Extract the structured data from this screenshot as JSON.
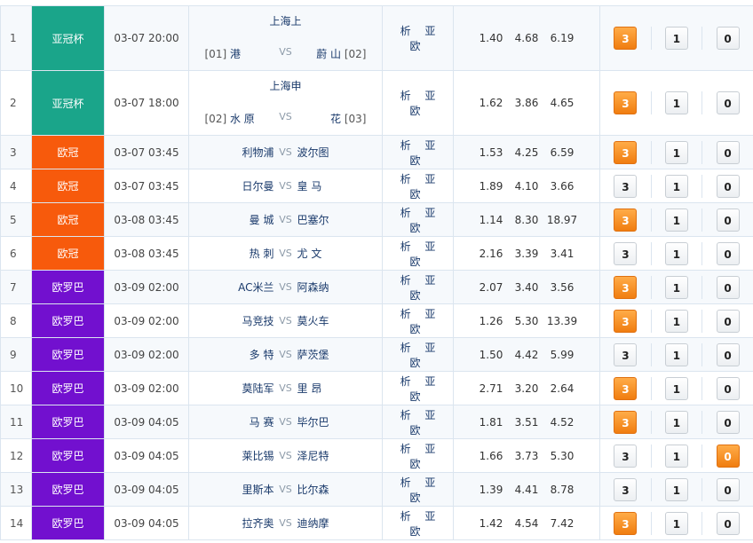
{
  "colors": {
    "league_acl": "#1aa58a",
    "league_ucl": "#f75a0c",
    "league_uel": "#7210cf",
    "selected_button": "#f5911f"
  },
  "matches": [
    {
      "index": "1",
      "league": "亚冠杯",
      "league_color": "#1aa58a",
      "time": "03-07 20:00",
      "home_top": "上海上",
      "home_rank": "[01]",
      "home": "港",
      "vs": "VS",
      "away": "蔚 山",
      "away_rank": "[02]",
      "analysis": "析 亚 欧",
      "odds": [
        "1.40",
        "4.68",
        "6.19"
      ],
      "options": [
        "3",
        "1",
        "0"
      ],
      "selected": "3"
    },
    {
      "index": "2",
      "league": "亚冠杯",
      "league_color": "#1aa58a",
      "time": "03-07 18:00",
      "away_top": "上海申",
      "home_rank": "[02]",
      "home": "水 原",
      "vs": "VS",
      "away": "花",
      "away_rank": "[03]",
      "analysis": "析 亚 欧",
      "odds": [
        "1.62",
        "3.86",
        "4.65"
      ],
      "options": [
        "3",
        "1",
        "0"
      ],
      "selected": "3"
    },
    {
      "index": "3",
      "league": "欧冠",
      "league_color": "#f75a0c",
      "time": "03-07 03:45",
      "home": "利物浦",
      "vs": "VS",
      "away": "波尔图",
      "analysis": "析 亚 欧",
      "odds": [
        "1.53",
        "4.25",
        "6.59"
      ],
      "options": [
        "3",
        "1",
        "0"
      ],
      "selected": "3"
    },
    {
      "index": "4",
      "league": "欧冠",
      "league_color": "#f75a0c",
      "time": "03-07 03:45",
      "home": "日尔曼",
      "vs": "VS",
      "away": "皇 马",
      "analysis": "析 亚 欧",
      "odds": [
        "1.89",
        "4.10",
        "3.66"
      ],
      "options": [
        "3",
        "1",
        "0"
      ],
      "selected": ""
    },
    {
      "index": "5",
      "league": "欧冠",
      "league_color": "#f75a0c",
      "time": "03-08 03:45",
      "home": "曼 城",
      "vs": "VS",
      "away": "巴塞尔",
      "analysis": "析 亚 欧",
      "odds": [
        "1.14",
        "8.30",
        "18.97"
      ],
      "options": [
        "3",
        "1",
        "0"
      ],
      "selected": "3"
    },
    {
      "index": "6",
      "league": "欧冠",
      "league_color": "#f75a0c",
      "time": "03-08 03:45",
      "home": "热 刺",
      "vs": "VS",
      "away": "尤 文",
      "analysis": "析 亚 欧",
      "odds": [
        "2.16",
        "3.39",
        "3.41"
      ],
      "options": [
        "3",
        "1",
        "0"
      ],
      "selected": ""
    },
    {
      "index": "7",
      "league": "欧罗巴",
      "league_color": "#7210cf",
      "time": "03-09 02:00",
      "home": "AC米兰",
      "vs": "VS",
      "away": "阿森纳",
      "analysis": "析 亚 欧",
      "odds": [
        "2.07",
        "3.40",
        "3.56"
      ],
      "options": [
        "3",
        "1",
        "0"
      ],
      "selected": "3"
    },
    {
      "index": "8",
      "league": "欧罗巴",
      "league_color": "#7210cf",
      "time": "03-09 02:00",
      "home": "马竞技",
      "vs": "VS",
      "away": "莫火车",
      "analysis": "析 亚 欧",
      "odds": [
        "1.26",
        "5.30",
        "13.39"
      ],
      "options": [
        "3",
        "1",
        "0"
      ],
      "selected": "3"
    },
    {
      "index": "9",
      "league": "欧罗巴",
      "league_color": "#7210cf",
      "time": "03-09 02:00",
      "home": "多 特",
      "vs": "VS",
      "away": "萨茨堡",
      "analysis": "析 亚 欧",
      "odds": [
        "1.50",
        "4.42",
        "5.99"
      ],
      "options": [
        "3",
        "1",
        "0"
      ],
      "selected": ""
    },
    {
      "index": "10",
      "league": "欧罗巴",
      "league_color": "#7210cf",
      "time": "03-09 02:00",
      "home": "莫陆军",
      "vs": "VS",
      "away": "里 昂",
      "analysis": "析 亚 欧",
      "odds": [
        "2.71",
        "3.20",
        "2.64"
      ],
      "options": [
        "3",
        "1",
        "0"
      ],
      "selected": "3"
    },
    {
      "index": "11",
      "league": "欧罗巴",
      "league_color": "#7210cf",
      "time": "03-09 04:05",
      "home": "马 赛",
      "vs": "VS",
      "away": "毕尔巴",
      "analysis": "析 亚 欧",
      "odds": [
        "1.81",
        "3.51",
        "4.52"
      ],
      "options": [
        "3",
        "1",
        "0"
      ],
      "selected": "3"
    },
    {
      "index": "12",
      "league": "欧罗巴",
      "league_color": "#7210cf",
      "time": "03-09 04:05",
      "home": "莱比锡",
      "vs": "VS",
      "away": "泽尼特",
      "analysis": "析 亚 欧",
      "odds": [
        "1.66",
        "3.73",
        "5.30"
      ],
      "options": [
        "3",
        "1",
        "0"
      ],
      "selected": "0"
    },
    {
      "index": "13",
      "league": "欧罗巴",
      "league_color": "#7210cf",
      "time": "03-09 04:05",
      "home": "里斯本",
      "vs": "VS",
      "away": "比尔森",
      "analysis": "析 亚 欧",
      "odds": [
        "1.39",
        "4.41",
        "8.78"
      ],
      "options": [
        "3",
        "1",
        "0"
      ],
      "selected": ""
    },
    {
      "index": "14",
      "league": "欧罗巴",
      "league_color": "#7210cf",
      "time": "03-09 04:05",
      "home": "拉齐奥",
      "vs": "VS",
      "away": "迪纳摩",
      "analysis": "析 亚 欧",
      "odds": [
        "1.42",
        "4.54",
        "7.42"
      ],
      "options": [
        "3",
        "1",
        "0"
      ],
      "selected": "3"
    }
  ]
}
